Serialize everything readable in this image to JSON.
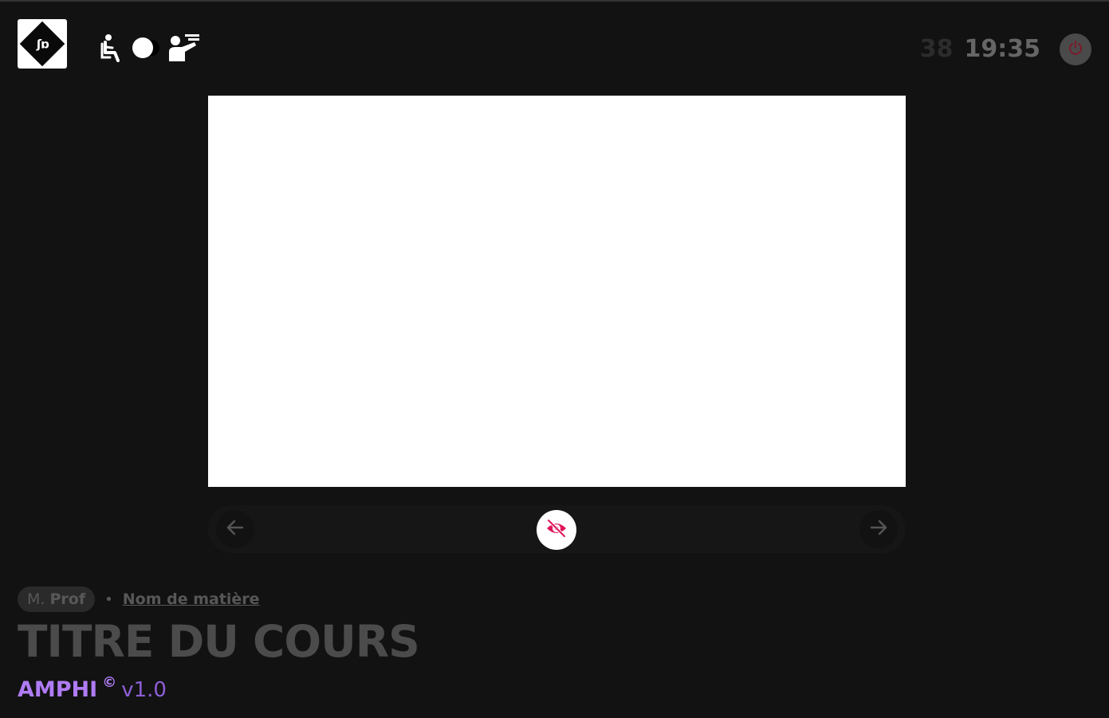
{
  "header": {
    "logo_text": "ʃɒ",
    "mode_icons": [
      "seated-student-icon",
      "teacher-presenting-icon"
    ],
    "toggle_state": "student",
    "clock": {
      "seconds": "38",
      "time": "19:35"
    },
    "power_icon": "power-icon"
  },
  "player": {
    "prev_icon": "arrow-left-icon",
    "visibility_icon": "eye-off-icon",
    "next_icon": "arrow-right-icon"
  },
  "course": {
    "prof_prefix": "M.",
    "prof_name": "Prof",
    "separator": "•",
    "subject": "Nom de matière",
    "title": "TITRE DU COURS"
  },
  "brand": {
    "name": "AMPHI",
    "copyright": "©",
    "version": "v1.0"
  },
  "colors": {
    "background": "#121212",
    "accent_purple": "#b07cf5",
    "accent_pink": "#e0155a",
    "power_red": "#7a1a2c"
  }
}
